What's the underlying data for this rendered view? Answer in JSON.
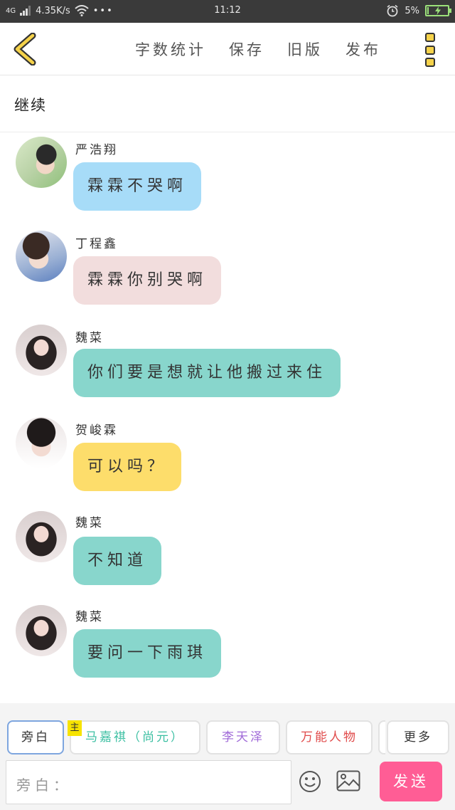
{
  "status_bar": {
    "network": "4G",
    "speed": "4.35K/s",
    "dots": "•••",
    "time": "11:12",
    "battery": "5%",
    "battery_level": 0.05
  },
  "top_nav": {
    "actions": [
      "字数统计",
      "保存",
      "旧版",
      "发布"
    ]
  },
  "continue_label": "继续",
  "messages": [
    {
      "sender": "严浩翔",
      "text": "霖霖不哭啊",
      "bubble_color": "#a7dcf8"
    },
    {
      "sender": "丁程鑫",
      "text": "霖霖你别哭啊",
      "bubble_color": "#f2dddd"
    },
    {
      "sender": "魏菜",
      "text": "你们要是想就让他搬过来住",
      "bubble_color": "#88d6cc"
    },
    {
      "sender": "贺峻霖",
      "text": "可以吗？",
      "bubble_color": "#fddd6b"
    },
    {
      "sender": "魏菜",
      "text": "不知道",
      "bubble_color": "#88d6cc"
    },
    {
      "sender": "魏菜",
      "text": "要问一下雨琪",
      "bubble_color": "#88d6cc"
    }
  ],
  "roles": {
    "narration": "旁白",
    "host_tag": "主",
    "host": "马嘉祺（尚元）",
    "role2": "李天泽",
    "role3": "万能人物",
    "more": "更多"
  },
  "role_colors": {
    "host": "#3bbfa2",
    "role2": "#a06ad8",
    "role3": "#e04a4a",
    "narration": "#333333",
    "more": "#333333"
  },
  "input": {
    "placeholder": "旁白："
  },
  "send_label": "发送",
  "icons": [
    "back-chevron-icon",
    "menu-icon",
    "emoji-icon",
    "image-icon",
    "wifi-icon",
    "alarm-icon",
    "battery-icon"
  ]
}
